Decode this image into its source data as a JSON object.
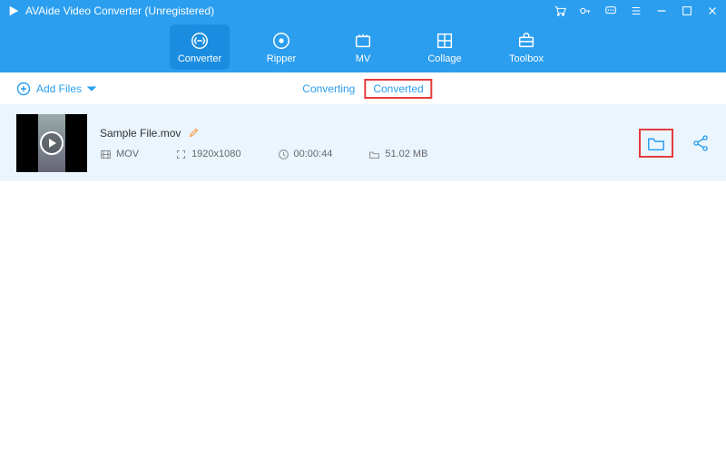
{
  "titlebar": {
    "title": "AVAide Video Converter (Unregistered)"
  },
  "tabs": {
    "converter": "Converter",
    "ripper": "Ripper",
    "mv": "MV",
    "collage": "Collage",
    "toolbox": "Toolbox"
  },
  "addfiles": {
    "label": "Add Files"
  },
  "subtabs": {
    "converting": "Converting",
    "converted": "Converted"
  },
  "file": {
    "name": "Sample File.mov",
    "format": "MOV",
    "resolution": "1920x1080",
    "duration": "00:00:44",
    "size": "51.02 MB"
  }
}
